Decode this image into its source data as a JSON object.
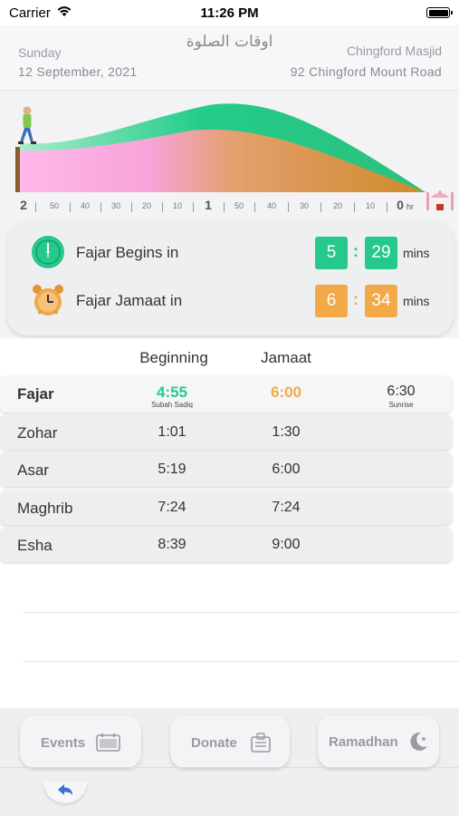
{
  "status_bar": {
    "carrier": "Carrier",
    "time": "11:26 PM"
  },
  "header": {
    "day": "Sunday",
    "date": "12 September, 2021",
    "arabic_title": "اوقات الصلوة",
    "masjid_name": "Chingford Masjid",
    "address": "92 Chingford Mount Road"
  },
  "timeline": {
    "ticks": [
      "2",
      "50",
      "40",
      "30",
      "20",
      "10",
      "1",
      "50",
      "40",
      "30",
      "20",
      "10",
      "0"
    ],
    "unit": "hr",
    "colors": {
      "green": "#2ecf8f",
      "pink": "#ffb3e6",
      "orange": "#d9902c"
    }
  },
  "countdown": {
    "begins": {
      "label": "Fajar Begins in",
      "hours": "5",
      "minutes": "29",
      "unit": "mins",
      "color": "#26c98c",
      "icon": "clock-icon"
    },
    "jamaat": {
      "label": "Fajar Jamaat in",
      "hours": "6",
      "minutes": "34",
      "unit": "mins",
      "color": "#f2a947",
      "icon": "alarm-clock-icon"
    },
    "separator": ":"
  },
  "table": {
    "headers": {
      "beginning": "Beginning",
      "jamaat": "Jamaat"
    },
    "fajar": {
      "name": "Fajar",
      "beginning": "4:55",
      "beginning_note": "Subah Sadiq",
      "jamaat": "6:00",
      "sunrise": "6:30",
      "sunrise_note": "Sunrise"
    },
    "rows": [
      {
        "name": "Zohar",
        "beginning": "1:01",
        "jamaat": "1:30"
      },
      {
        "name": "Asar",
        "beginning": "5:19",
        "jamaat": "6:00"
      },
      {
        "name": "Maghrib",
        "beginning": "7:24",
        "jamaat": "7:24"
      },
      {
        "name": "Esha",
        "beginning": "8:39",
        "jamaat": "9:00"
      }
    ]
  },
  "bottom_nav": {
    "events": "Events",
    "donate": "Donate",
    "ramadhan": "Ramadhan"
  }
}
